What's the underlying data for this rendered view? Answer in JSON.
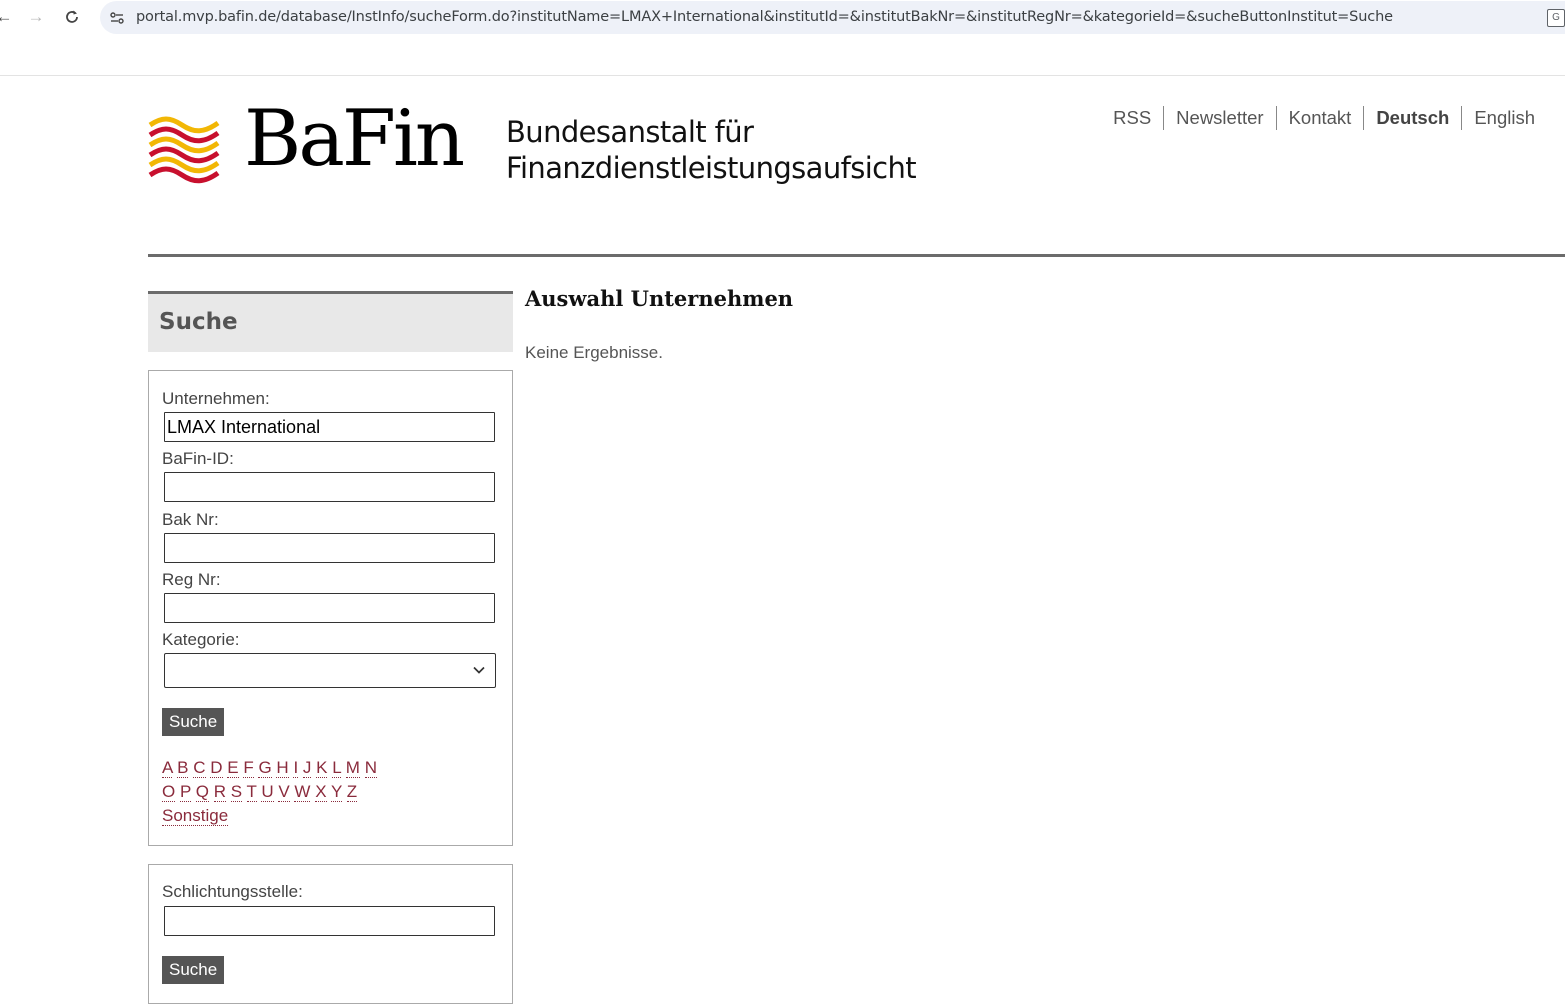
{
  "browser": {
    "url": "portal.mvp.bafin.de/database/InstInfo/sucheForm.do?institutName=LMAX+International&institutId=&institutBakNr=&institutRegNr=&kategorieId=&sucheButtonInstitut=Suche",
    "icons": [
      "back-icon",
      "forward-icon",
      "reload-icon",
      "site-info-icon",
      "translate-icon"
    ]
  },
  "header": {
    "logo_word": "BaFin",
    "tagline_line1": "Bundesanstalt für",
    "tagline_line2": "Finanzdienstleistungsaufsicht",
    "links": [
      "RSS",
      "Newsletter",
      "Kontakt",
      "Deutsch",
      "English"
    ],
    "active_link": "Deutsch"
  },
  "sidebar": {
    "title": "Suche",
    "search_form": {
      "company_label": "Unternehmen:",
      "company_value": "LMAX International",
      "bafin_id_label": "BaFin-ID:",
      "bafin_id_value": "",
      "bak_nr_label": "Bak Nr:",
      "bak_nr_value": "",
      "reg_nr_label": "Reg Nr:",
      "reg_nr_value": "",
      "category_label": "Kategorie:",
      "category_value": "",
      "submit_label": "Suche"
    },
    "alphabet_row1": [
      "A",
      "B",
      "C",
      "D",
      "E",
      "F",
      "G",
      "H",
      "I",
      "J",
      "K",
      "L",
      "M",
      "N"
    ],
    "alphabet_row2": [
      "O",
      "P",
      "Q",
      "R",
      "S",
      "T",
      "U",
      "V",
      "W",
      "X",
      "Y",
      "Z"
    ],
    "other_link": "Sonstige",
    "mediation_form": {
      "label": "Schlichtungsstelle:",
      "value": "",
      "submit_label": "Suche"
    }
  },
  "main": {
    "title": "Auswahl Unternehmen",
    "message": "Keine Ergebnisse."
  },
  "colors": {
    "link": "#8a2b3c",
    "button_bg": "#555555",
    "rule": "#6b6b6b",
    "panel_head_bg": "#e8e8e8",
    "logo_red": "#c8102e",
    "logo_gold": "#f2b705"
  }
}
